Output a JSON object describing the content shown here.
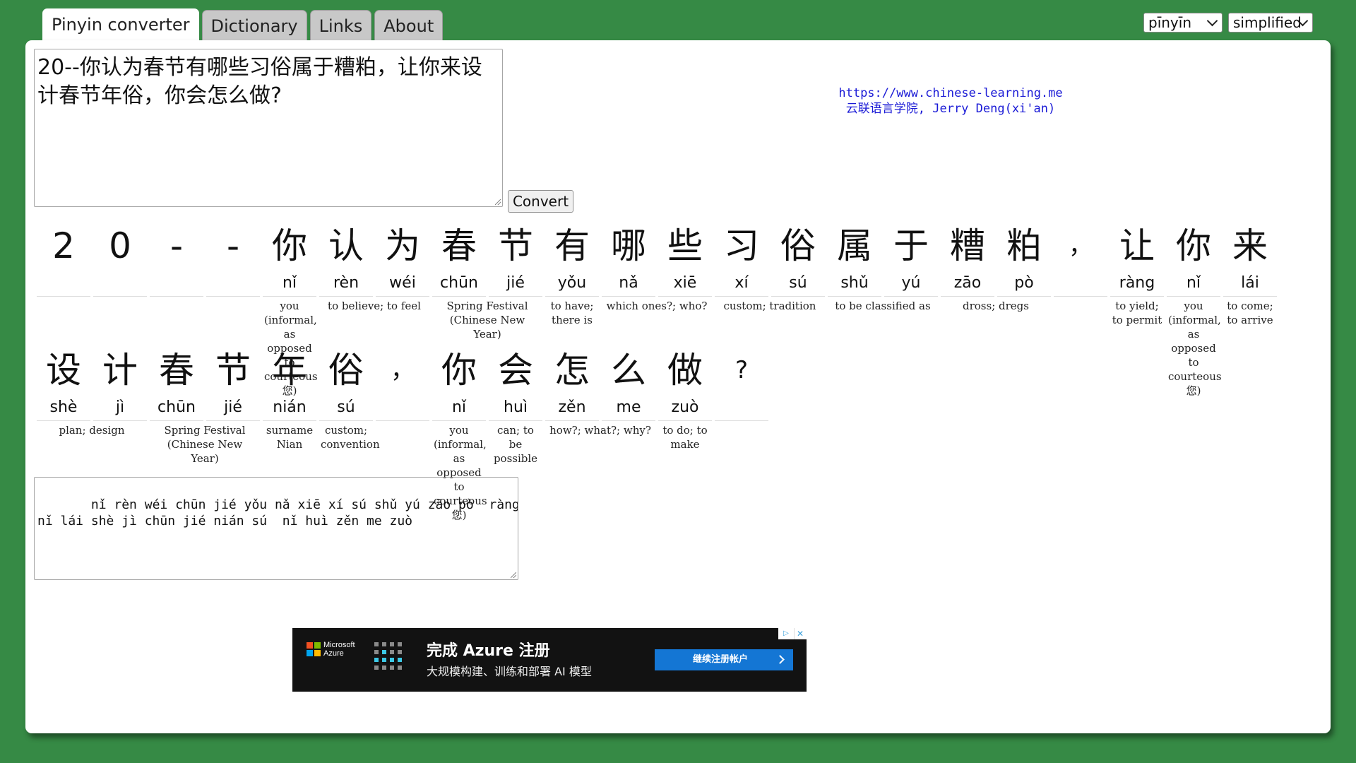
{
  "tabs": [
    {
      "label": "Pinyin converter",
      "active": true
    },
    {
      "label": "Dictionary",
      "active": false
    },
    {
      "label": "Links",
      "active": false
    },
    {
      "label": "About",
      "active": false
    }
  ],
  "selects": {
    "mode": "pīnyīn",
    "script": "simplified"
  },
  "input": {
    "text": "20--你认为春节有哪些习俗属于糟粕，让你来设计春节年俗，你会怎么做?"
  },
  "convert_label": "Convert",
  "credits": {
    "url": "https://www.chinese-learning.me",
    "author": "云联语言学院, Jerry Deng(xi'an)"
  },
  "rows": [
    [
      {
        "hanzi": "2",
        "pinyin": "",
        "def": ""
      },
      {
        "hanzi": "0",
        "pinyin": "",
        "def": ""
      },
      {
        "hanzi": "-",
        "pinyin": "",
        "def": ""
      },
      {
        "hanzi": "-",
        "pinyin": "",
        "def": ""
      },
      {
        "hanzi": "你",
        "pinyin": "nǐ",
        "def": "you (informal, as opposed to courteous 您)"
      },
      {
        "hanzi": "认",
        "pinyin": "rèn",
        "def": "to believe; to feel",
        "wide": true
      },
      {
        "hanzi": "为",
        "pinyin": "wéi",
        "def": ""
      },
      {
        "hanzi": "春",
        "pinyin": "chūn",
        "def": "Spring Festival (Chinese New Year)",
        "wide": true
      },
      {
        "hanzi": "节",
        "pinyin": "jié",
        "def": ""
      },
      {
        "hanzi": "有",
        "pinyin": "yǒu",
        "def": "to have; there is"
      },
      {
        "hanzi": "哪",
        "pinyin": "nǎ",
        "def": "which ones?; who?",
        "wide": true
      },
      {
        "hanzi": "些",
        "pinyin": "xiē",
        "def": ""
      },
      {
        "hanzi": "习",
        "pinyin": "xí",
        "def": "custom; tradition",
        "wide": true
      },
      {
        "hanzi": "俗",
        "pinyin": "sú",
        "def": ""
      },
      {
        "hanzi": "属",
        "pinyin": "shǔ",
        "def": "to be classified as",
        "wide": true
      },
      {
        "hanzi": "于",
        "pinyin": "yú",
        "def": ""
      },
      {
        "hanzi": "糟",
        "pinyin": "zāo",
        "def": "dross; dregs",
        "wide": true
      },
      {
        "hanzi": "粕",
        "pinyin": "pò",
        "def": ""
      },
      {
        "hanzi": "，",
        "pinyin": "",
        "def": "",
        "punct": true
      },
      {
        "hanzi": "让",
        "pinyin": "ràng",
        "def": "to yield; to permit"
      },
      {
        "hanzi": "你",
        "pinyin": "nǐ",
        "def": "you (informal, as opposed to courteous 您)"
      },
      {
        "hanzi": "来",
        "pinyin": "lái",
        "def": "to come; to arrive"
      }
    ],
    [
      {
        "hanzi": "设",
        "pinyin": "shè",
        "def": "plan; design",
        "wide": true
      },
      {
        "hanzi": "计",
        "pinyin": "jì",
        "def": ""
      },
      {
        "hanzi": "春",
        "pinyin": "chūn",
        "def": "Spring Festival (Chinese New Year)",
        "wide": true
      },
      {
        "hanzi": "节",
        "pinyin": "jié",
        "def": ""
      },
      {
        "hanzi": "年",
        "pinyin": "nián",
        "def": "surname Nian"
      },
      {
        "hanzi": "俗",
        "pinyin": "sú",
        "def": "custom; convention"
      },
      {
        "hanzi": "，",
        "pinyin": "",
        "def": "",
        "punct": true
      },
      {
        "hanzi": "你",
        "pinyin": "nǐ",
        "def": "you (informal, as opposed to courteous 您)"
      },
      {
        "hanzi": "会",
        "pinyin": "huì",
        "def": "can; to be possible"
      },
      {
        "hanzi": "怎",
        "pinyin": "zěn",
        "def": "how?; what?; why?",
        "wide": true
      },
      {
        "hanzi": "么",
        "pinyin": "me",
        "def": ""
      },
      {
        "hanzi": "做",
        "pinyin": "zuò",
        "def": "to do; to make"
      },
      {
        "hanzi": "?",
        "pinyin": "",
        "def": "",
        "punct": true
      }
    ]
  ],
  "output": {
    "text": "   nǐ rèn wéi chūn jié yǒu nǎ xiē xí sú shǔ yú zāo pò  ràng\nnǐ lái shè jì chūn jié nián sú  nǐ huì zěn me zuò"
  },
  "ad": {
    "brand_line1": "Microsoft",
    "brand_line2": "Azure",
    "title": "完成 Azure 注册",
    "subtitle": "大规模构建、训练和部署 AI 模型",
    "cta": "继续注册帐户",
    "choices_icon": "adchoices-icon",
    "close_icon": "close-icon"
  }
}
